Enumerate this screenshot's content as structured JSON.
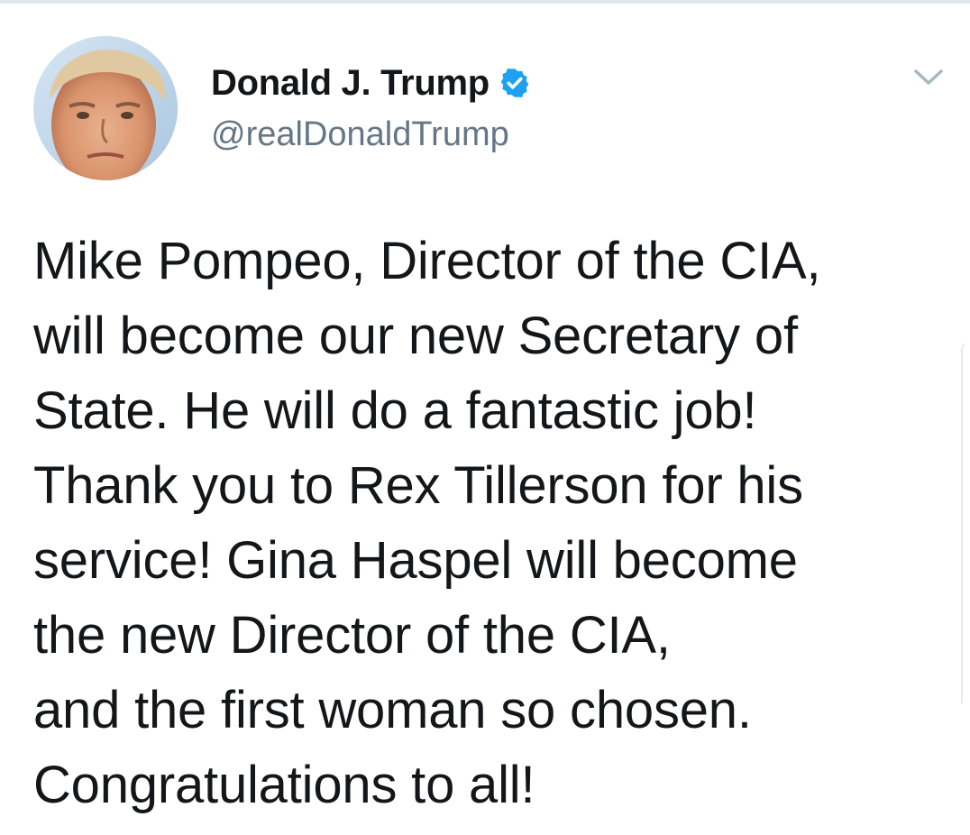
{
  "tweet": {
    "author": {
      "display_name": "Donald J. Trump",
      "handle": "@realDonaldTrump",
      "verified": true
    },
    "text_lines": [
      "Mike Pompeo, Director of the CIA,",
      "will become our new Secretary of",
      "State. He will do a fantastic job!",
      "Thank you to Rex Tillerson for his",
      "service! Gina Haspel will become",
      "the new Director of the CIA,",
      "and the first woman so chosen.",
      "Congratulations to all!"
    ]
  },
  "icons": {
    "verified": "verified-badge-icon",
    "menu": "chevron-down-icon"
  },
  "colors": {
    "text_primary": "#14171a",
    "text_secondary": "#657786",
    "verified_blue": "#1da1f2",
    "chevron": "#aab8c2"
  }
}
